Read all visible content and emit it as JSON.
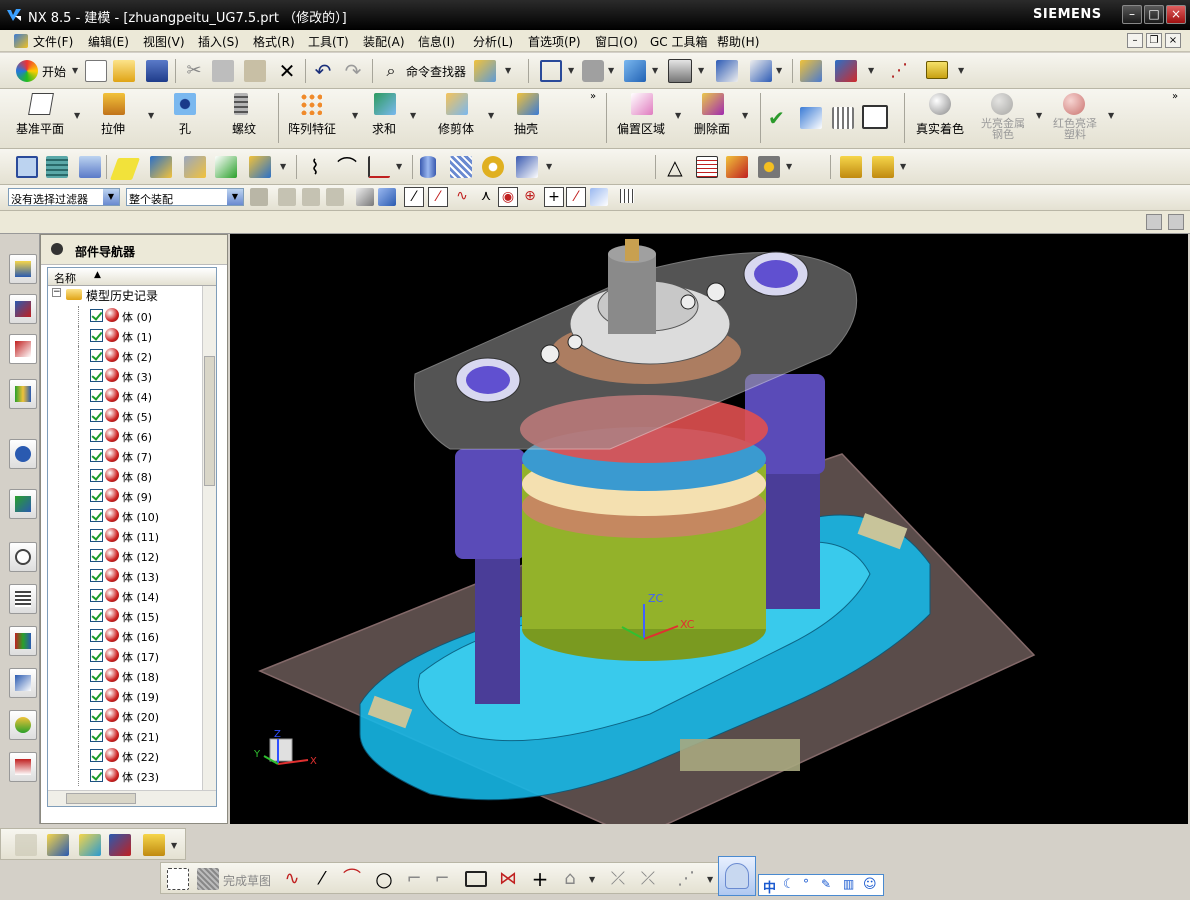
{
  "window": {
    "title": "NX 8.5 - 建模 - [zhuangpeitu_UG7.5.prt （修改的）]",
    "brand": "SIEMENS",
    "controls": {
      "minimize": "–",
      "maximize": "□",
      "close": "×"
    }
  },
  "menubar": {
    "items": [
      "文件(F)",
      "编辑(E)",
      "视图(V)",
      "插入(S)",
      "格式(R)",
      "工具(T)",
      "装配(A)",
      "信息(I)",
      "分析(L)",
      "首选项(P)",
      "窗口(O)",
      "GC 工具箱",
      "帮助(H)"
    ]
  },
  "standard_toolbar": {
    "start_label": "开始",
    "command_finder_label": "命令查找器"
  },
  "feature_toolbar": {
    "items": [
      "基准平面",
      "拉伸",
      "孔",
      "螺纹",
      "阵列特征",
      "求和",
      "修剪体",
      "抽壳",
      "偏置区域",
      "删除面",
      "真实着色",
      "光亮金属 钢色",
      "红色亮泽 塑料"
    ]
  },
  "selection_bar": {
    "filter_value": "没有选择过滤器",
    "scope_value": "整个装配"
  },
  "navigator": {
    "title": "部件导航器",
    "column_header": "名称",
    "root_label": "模型历史记录",
    "body_label": "体",
    "items": [
      "(0)",
      "(1)",
      "(2)",
      "(3)",
      "(4)",
      "(5)",
      "(6)",
      "(7)",
      "(8)",
      "(9)",
      "(10)",
      "(11)",
      "(12)",
      "(13)",
      "(14)",
      "(15)",
      "(16)",
      "(17)",
      "(18)",
      "(19)",
      "(20)",
      "(21)",
      "(22)",
      "(23)"
    ]
  },
  "viewport": {
    "csys_zc": "ZC",
    "csys_xc": "XC",
    "triad_x": "X",
    "triad_y": "Y",
    "triad_z": "Z"
  },
  "sketch_toolbar": {
    "finish_label": "完成草图"
  },
  "ime_bar": {
    "mode": "中"
  },
  "colors": {
    "viewport_bg": "#000000",
    "base_plate": "#17b7e6",
    "cylinder": "#93b22a",
    "posts": "#5a4bb0",
    "top_plate": "#8a8a8a"
  }
}
